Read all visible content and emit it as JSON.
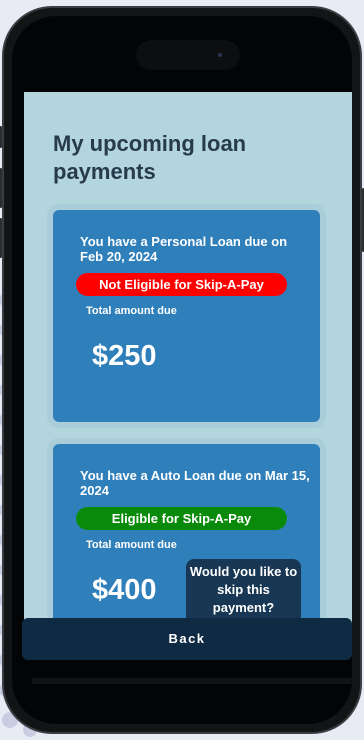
{
  "page": {
    "title": "My upcoming loan payments"
  },
  "loans": [
    {
      "due_text": "You have a Personal Loan due on Feb 20, 2024",
      "status_label": "Not Eligible for Skip-A-Pay",
      "total_label": "Total amount due",
      "amount": "$250"
    },
    {
      "due_text": "You have a Auto Loan due on Mar 15, 2024",
      "status_label": "Eligible for Skip-A-Pay",
      "total_label": "Total amount due",
      "amount": "$400",
      "skip_button_label": "Would you like to skip this payment?"
    }
  ],
  "footer": {
    "back_label": "Back"
  },
  "colors": {
    "screen_bg": "#b3d5de",
    "card_bg": "#2f7fba",
    "not_eligible": "#ff0000",
    "eligible": "#0a8a0a",
    "dark_button": "#0f2b44"
  }
}
